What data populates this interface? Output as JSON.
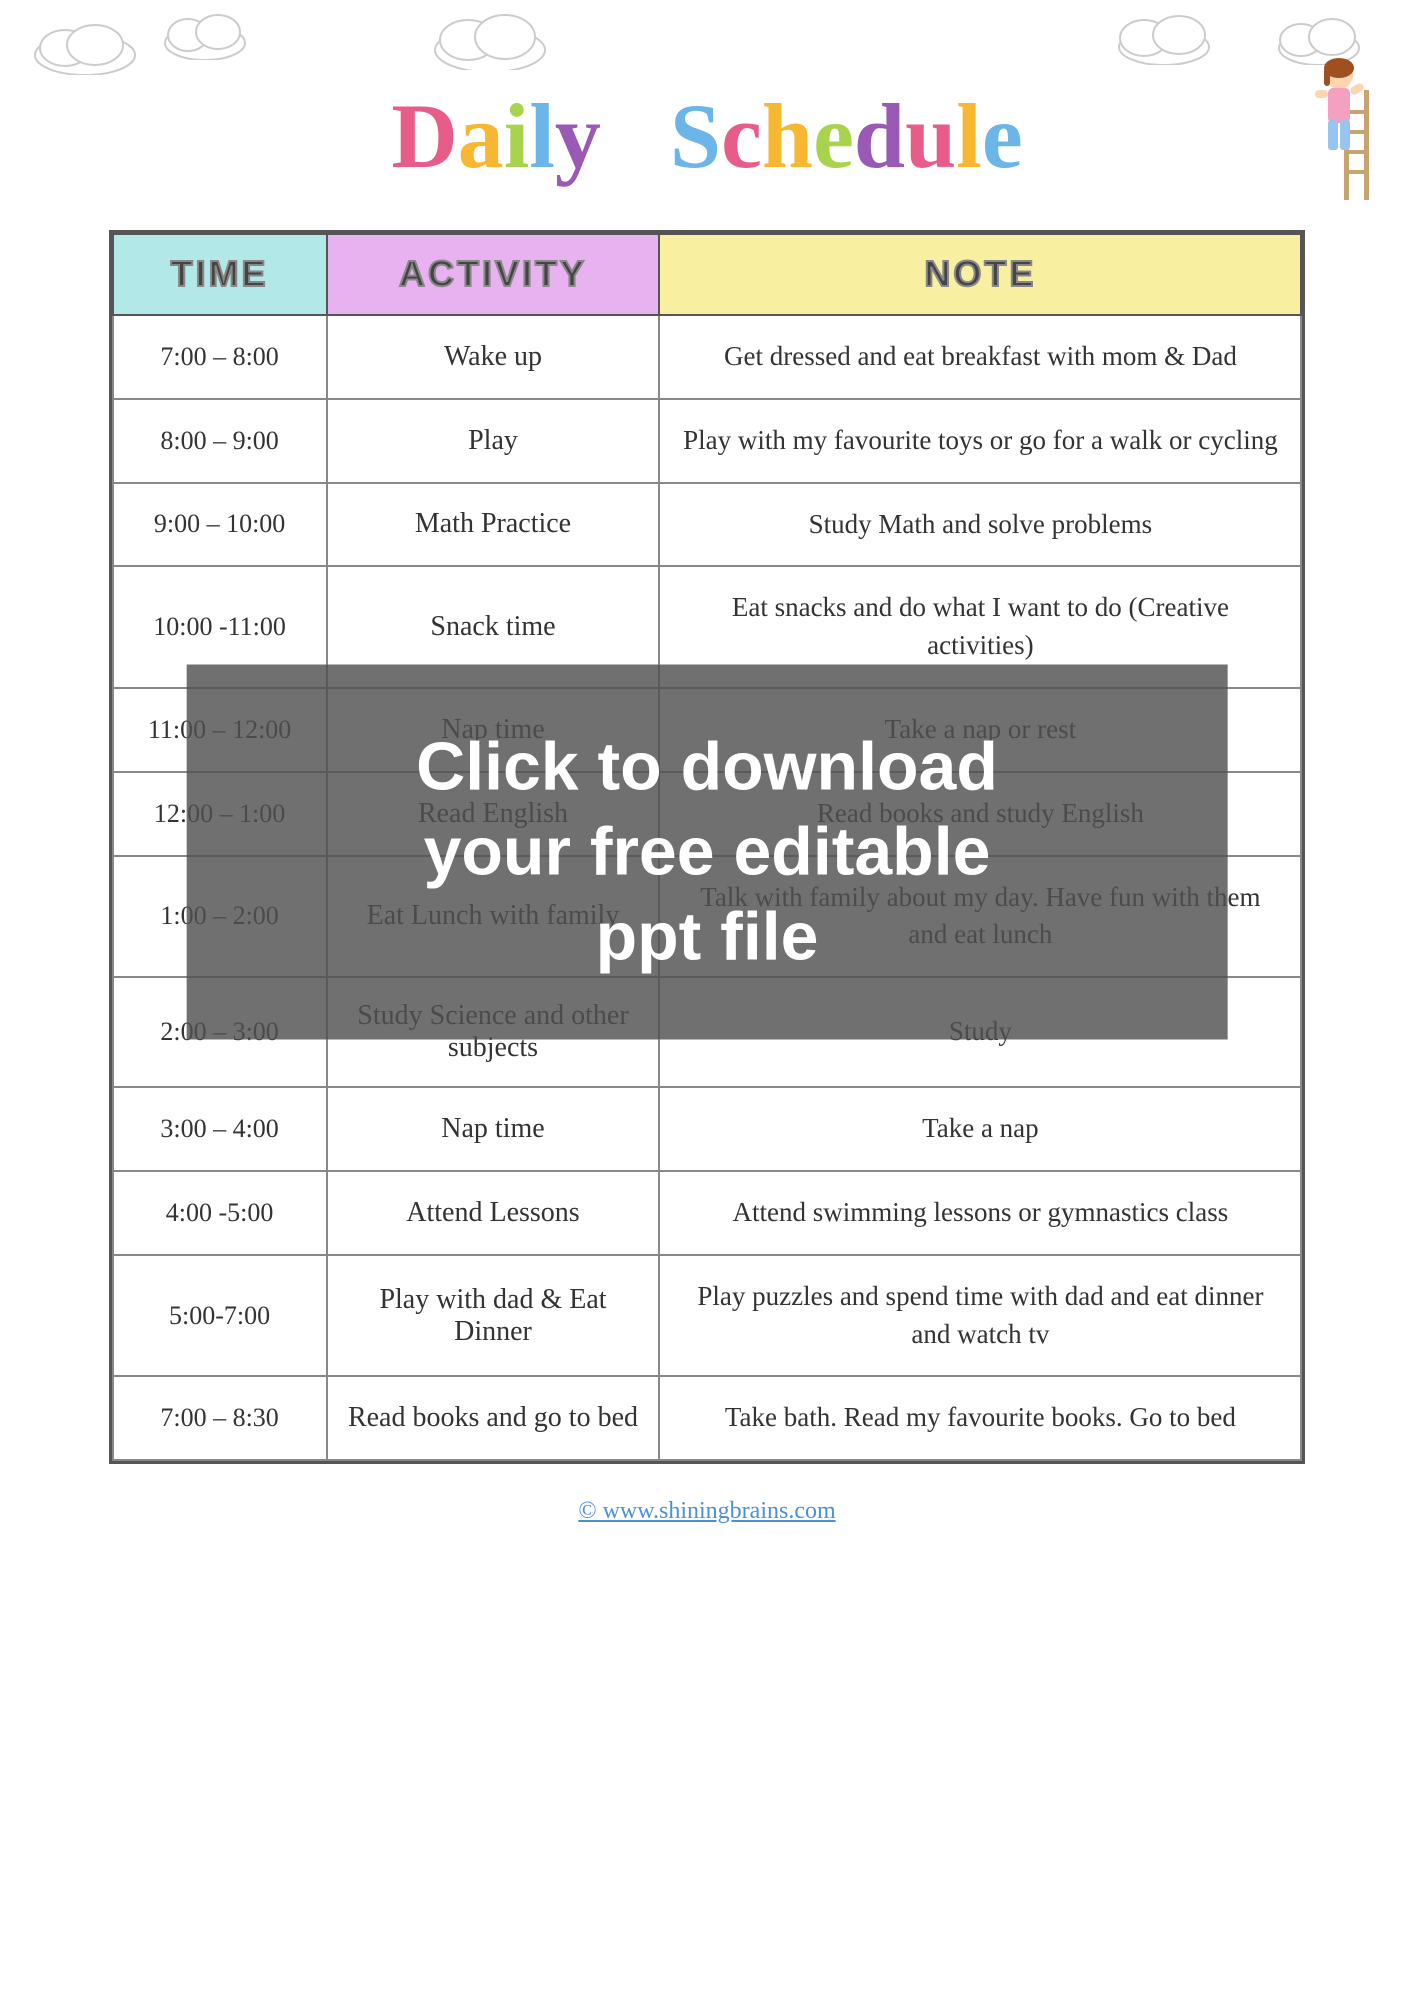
{
  "header": {
    "title_word1": "Daily",
    "title_word2": "Schedule"
  },
  "table": {
    "columns": {
      "time": "TIME",
      "activity": "ACTIVITY",
      "note": "NOTE"
    },
    "rows": [
      {
        "time": "7:00 – 8:00",
        "activity": "Wake up",
        "note": "Get dressed and eat breakfast with mom & Dad"
      },
      {
        "time": "8:00 – 9:00",
        "activity": "Play",
        "note": "Play with my favourite toys or go for a walk or cycling"
      },
      {
        "time": "9:00 – 10:00",
        "activity": "Math Practice",
        "note": "Study Math and solve problems"
      },
      {
        "time": "10:00 -11:00",
        "activity": "Snack time",
        "note": "Eat snacks and do what I want to do (Creative activities)"
      },
      {
        "time": "11:00 – 12:00",
        "activity": "Nap time",
        "note": "Take a nap or rest"
      },
      {
        "time": "12:00 – 1:00",
        "activity": "Read English",
        "note": "Read books and study English"
      },
      {
        "time": "1:00 – 2:00",
        "activity": "Eat Lunch with family",
        "note": "Talk with family about my day. Have fun with them and eat lunch"
      },
      {
        "time": "2:00 – 3:00",
        "activity": "Study Science and other subjects",
        "note": "Study"
      },
      {
        "time": "3:00 – 4:00",
        "activity": "Nap time",
        "note": "Take a nap"
      },
      {
        "time": "4:00 -5:00",
        "activity": "Attend Lessons",
        "note": "Attend swimming lessons or gymnastics class"
      },
      {
        "time": "5:00-7:00",
        "activity": "Play with dad & Eat Dinner",
        "note": "Play puzzles and spend time with dad and eat dinner and watch tv"
      },
      {
        "time": "7:00 – 8:30",
        "activity": "Read books and go to bed",
        "note": "Take bath. Read my favourite books. Go to bed"
      }
    ]
  },
  "watermark": {
    "line1": "Click to download",
    "line2": "your free editable",
    "line3": "ppt file"
  },
  "footer": {
    "link": "© www.shiningbrains.com"
  }
}
